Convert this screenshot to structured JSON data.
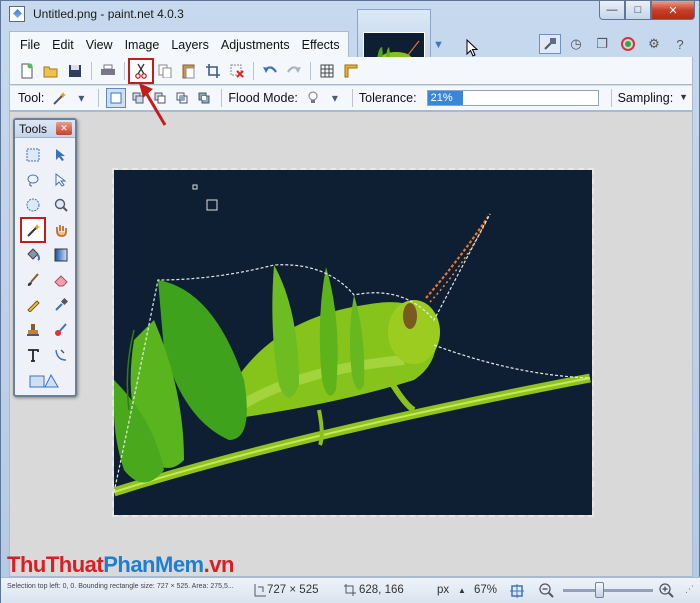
{
  "window": {
    "title": "Untitled.png - paint.net 4.0.3",
    "controls": {
      "minimize": "—",
      "maximize": "□",
      "close": "✕"
    }
  },
  "menu": [
    "File",
    "Edit",
    "View",
    "Image",
    "Layers",
    "Adjustments",
    "Effects"
  ],
  "toolbar": {
    "items": [
      "new-icon",
      "open-icon",
      "save-icon",
      "sep",
      "print-icon",
      "sep",
      "cut-icon",
      "copy-icon",
      "paste-icon",
      "crop-icon",
      "deselect-icon",
      "sep",
      "undo-icon",
      "redo-icon",
      "sep",
      "grid-icon",
      "ruler-icon"
    ],
    "highlighted": "cut-icon"
  },
  "tool_options": {
    "tool_label": "Tool:",
    "flood_mode_label": "Flood Mode:",
    "tolerance_label": "Tolerance:",
    "tolerance_value": "21%",
    "tolerance_fraction": 0.21,
    "sampling_label": "Sampling:"
  },
  "tools_window": {
    "title": "Tools",
    "tools": [
      "rectangle-select-icon",
      "move-selection-icon",
      "lasso-select-icon",
      "move-selected-icon",
      "ellipse-select-icon",
      "zoom-icon",
      "magic-wand-icon",
      "pan-icon",
      "paint-bucket-icon",
      "gradient-icon",
      "paintbrush-icon",
      "eraser-icon",
      "pencil-icon",
      "color-picker-icon",
      "clone-stamp-icon",
      "recolor-icon",
      "text-icon",
      "line-curve-icon",
      "shapes-icon"
    ],
    "selected": "magic-wand-icon"
  },
  "status": {
    "selection_info": "Selection top left: 0, 0. Bounding rectangle size: 727 × 525. Area: 275,5...",
    "image_size": "727 × 525",
    "cursor_pos": "628, 166",
    "units": "px",
    "zoom": "67%",
    "zoom_fraction": 0.4
  },
  "watermark": {
    "part1": "ThuThuat",
    "part2": "PhanMem",
    "part3": ".vn"
  },
  "colors": {
    "canvas_bg": "#0e1f33",
    "highlight_red": "#c21d1d",
    "accent_blue": "#3a87d9"
  }
}
